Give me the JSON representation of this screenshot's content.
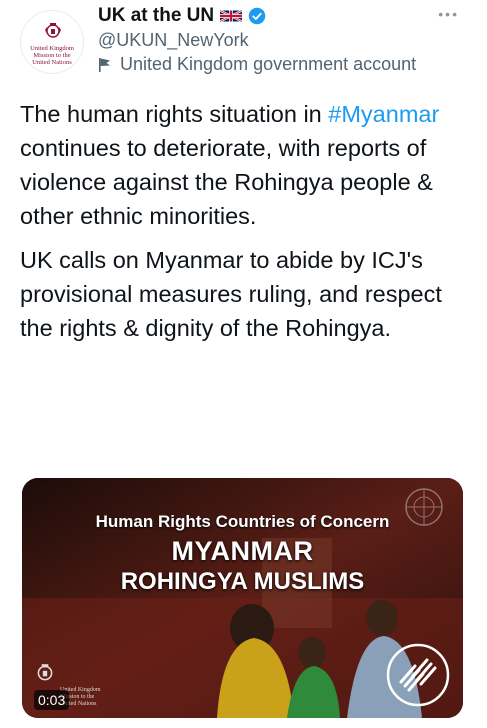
{
  "account": {
    "display_name": "UK at the UN",
    "handle": "@UKUN_NewYork",
    "label": "United Kingdom government account",
    "avatar_text": "United Kingdom Mission to the United Nations"
  },
  "tweet": {
    "p1_before": "The human rights situation in ",
    "hashtag": "#Myanmar",
    "p1_after": " continues to deteriorate, with reports of violence against the Rohingya people & other ethnic minorities.",
    "p2": "UK calls on Myanmar to abide by ICJ's provisional measures ruling, and respect the rights & dignity of the Rohingya."
  },
  "media": {
    "line1": "Human Rights Countries of Concern",
    "line2": "MYANMAR",
    "line3": "ROHINGYA MUSLIMS",
    "duration": "0:03",
    "uk_text": "United Kingdom Mission to the United Nations"
  },
  "icons": {
    "more": "more-options-icon",
    "verified": "verified-badge-icon",
    "flag": "union-jack-flag-icon",
    "gov": "government-flag-icon"
  },
  "colors": {
    "link": "#1d9bf0",
    "text": "#0f1419",
    "muted": "#536471"
  }
}
